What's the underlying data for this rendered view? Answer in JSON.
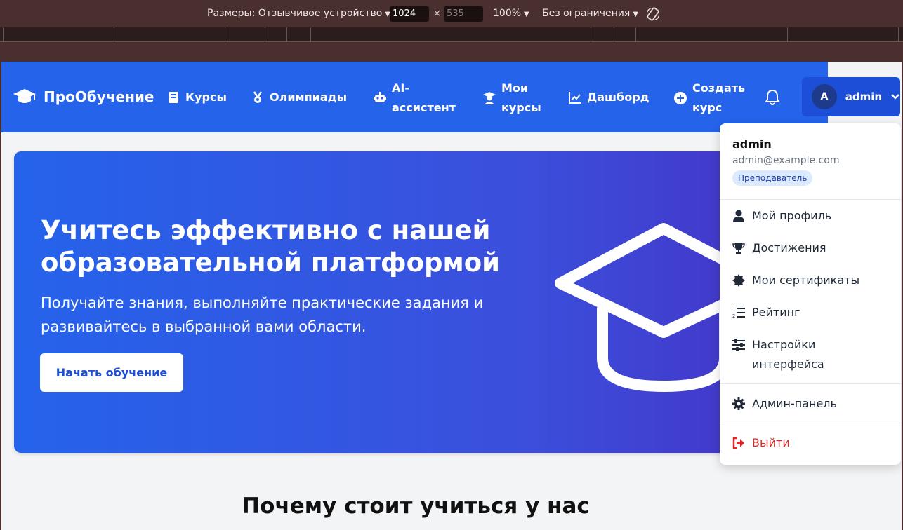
{
  "devtools": {
    "dimensions_label": "Размеры: Отзывчивое устройство",
    "width": "1024",
    "times": "×",
    "height": "535",
    "zoom": "100%",
    "throttle": "Без ограничения"
  },
  "navbar": {
    "brand": "ПроОбучение",
    "items": [
      {
        "label": "Курсы",
        "icon": "book-icon"
      },
      {
        "label": "Олимпиады",
        "icon": "medal-icon"
      },
      {
        "label": "AI-ассистент",
        "icon": "robot-icon"
      },
      {
        "label": "Мои курсы",
        "icon": "graduate-icon"
      },
      {
        "label": "Дашборд",
        "icon": "chart-line-icon"
      },
      {
        "label": "Создать курс",
        "icon": "plus-circle-icon"
      }
    ],
    "user": {
      "initial": "A",
      "name": "admin"
    }
  },
  "hero": {
    "title": "Учитесь эффективно с нашей образовательной платформой",
    "subtitle": "Получайте знания, выполняйте практические задания и развивайтесь в выбранной вами области.",
    "cta": "Начать обучение"
  },
  "section": {
    "title": "Почему стоит учиться у нас"
  },
  "dropdown": {
    "name": "admin",
    "email": "admin@example.com",
    "role": "Преподаватель",
    "items": [
      {
        "label": "Мой профиль",
        "icon": "user-icon"
      },
      {
        "label": "Достижения",
        "icon": "trophy-icon"
      },
      {
        "label": "Мои сертификаты",
        "icon": "certificate-icon"
      },
      {
        "label": "Рейтинг",
        "icon": "ranking-list-icon"
      },
      {
        "label": "Настройки интерфейса",
        "icon": "sliders-icon"
      },
      {
        "label": "Админ-панель",
        "icon": "gear-icon"
      },
      {
        "label": "Выйти",
        "icon": "logout-icon"
      }
    ]
  },
  "colors": {
    "primary": "#2563eb",
    "danger": "#dc2626"
  }
}
